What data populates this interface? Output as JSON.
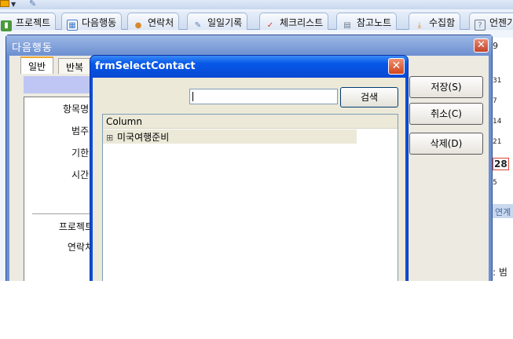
{
  "toolbar": {
    "tabs": [
      {
        "label": "프로젝트",
        "icon": "project-icon",
        "color": "#4a9a3c"
      },
      {
        "label": "다음행동",
        "icon": "calendar-icon",
        "color": "#3c7ac9"
      },
      {
        "label": "연락처",
        "icon": "contact-icon",
        "color": "#d9892a"
      },
      {
        "label": "일일기록",
        "icon": "diary-icon",
        "color": "#5b7fb8"
      },
      {
        "label": "체크리스트",
        "icon": "check-icon",
        "color": "#d23a2a"
      },
      {
        "label": "참고노트",
        "icon": "note-icon",
        "color": "#6a7a8c"
      },
      {
        "label": "수집함",
        "icon": "inbox-icon",
        "color": "#d9892a"
      },
      {
        "label": "언젠가",
        "icon": "question-icon",
        "color": "#6a7a8c"
      }
    ]
  },
  "bg_window": {
    "title": "다음행동",
    "tabs": [
      "일반",
      "반복"
    ],
    "fields": [
      "항목명 :",
      "범주 :",
      "기한 :",
      "시간 :",
      "프로젝트",
      "연락처"
    ],
    "buttons": {
      "save": "저장(S)",
      "cancel": "취소(C)",
      "delete": "삭제(D)"
    }
  },
  "calendar_edge": {
    "day_numbers": [
      "31",
      "7",
      "14",
      "21",
      "28",
      "5"
    ],
    "partial_header": "9",
    "link_text": "연계",
    "partial_text": ": 범"
  },
  "dialog": {
    "title": "frmSelectContact",
    "search_value": "",
    "search_button": "검색",
    "grid_header": "Column",
    "rows": [
      "미국여행준비"
    ]
  },
  "colors": {
    "dialog_title_blue": "#0858e8",
    "close_red": "#d2451d",
    "panel_beige": "#ece9d8",
    "accent_lavender": "#bfc6f3"
  }
}
